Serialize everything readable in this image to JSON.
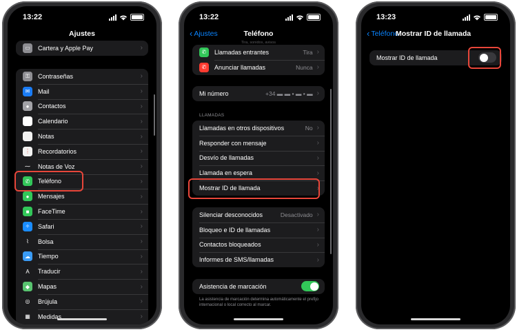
{
  "screens": {
    "ajustes": {
      "time": "13:22",
      "title": "Ajustes",
      "top_item": "Cartera y Apple Pay",
      "items": [
        {
          "label": "Contraseñas",
          "icon": "key-icon",
          "color": "#8e8e93",
          "glyph": "⚿"
        },
        {
          "label": "Mail",
          "icon": "mail-icon",
          "color": "#1a7cf5",
          "glyph": "✉"
        },
        {
          "label": "Contactos",
          "icon": "contacts-icon",
          "color": "#a2a2a7",
          "glyph": "●"
        },
        {
          "label": "Calendario",
          "icon": "calendar-icon",
          "color": "#ffffff",
          "glyph": ""
        },
        {
          "label": "Notas",
          "icon": "notes-icon",
          "color": "#f2f2f2",
          "glyph": ""
        },
        {
          "label": "Recordatorios",
          "icon": "reminders-icon",
          "color": "#f2f2f2",
          "glyph": "⋮"
        },
        {
          "label": "Notas de Voz",
          "icon": "voice-memos-icon",
          "color": "#1c1c1e",
          "glyph": "⁓"
        },
        {
          "label": "Teléfono",
          "icon": "phone-icon",
          "color": "#32c759",
          "glyph": "✆"
        },
        {
          "label": "Mensajes",
          "icon": "messages-icon",
          "color": "#32c759",
          "glyph": "●"
        },
        {
          "label": "FaceTime",
          "icon": "facetime-icon",
          "color": "#32c759",
          "glyph": "■"
        },
        {
          "label": "Safari",
          "icon": "safari-icon",
          "color": "#1a8cff",
          "glyph": "✧"
        },
        {
          "label": "Bolsa",
          "icon": "stocks-icon",
          "color": "#1c1c1e",
          "glyph": "⌇"
        },
        {
          "label": "Tiempo",
          "icon": "weather-icon",
          "color": "#3a9bf5",
          "glyph": "☁"
        },
        {
          "label": "Traducir",
          "icon": "translate-icon",
          "color": "#1c1c1e",
          "glyph": "A"
        },
        {
          "label": "Mapas",
          "icon": "maps-icon",
          "color": "#58c36f",
          "glyph": "◆"
        },
        {
          "label": "Brújula",
          "icon": "compass-icon",
          "color": "#1c1c1e",
          "glyph": "◎"
        },
        {
          "label": "Medidas",
          "icon": "measure-icon",
          "color": "#1c1c1e",
          "glyph": "▦"
        }
      ]
    },
    "telefono": {
      "time": "13:22",
      "back": "Ajustes",
      "title": "Teléfono",
      "cut_text": "Tira, sonidos, avisos",
      "top_rows": [
        {
          "label": "Llamadas entrantes",
          "value": "Tira",
          "icon": "incoming-call-icon",
          "color": "#32c759"
        },
        {
          "label": "Anunciar llamadas",
          "value": "Nunca",
          "icon": "announce-calls-icon",
          "color": "#ff3b30"
        }
      ],
      "my_number_label": "Mi número",
      "my_number_value": "+34 ▬ ▬ ▪ ▬ ▪ ▬",
      "section_header": "LLAMADAS",
      "calls_rows": [
        {
          "label": "Llamadas en otros dispositivos",
          "value": "No"
        },
        {
          "label": "Responder con mensaje",
          "value": ""
        },
        {
          "label": "Desvío de llamadas",
          "value": ""
        },
        {
          "label": "Llamada en espera",
          "value": ""
        },
        {
          "label": "Mostrar ID de llamada",
          "value": ""
        }
      ],
      "block_rows": [
        {
          "label": "Silenciar desconocidos",
          "value": "Desactivado"
        },
        {
          "label": "Bloqueo e ID de llamadas",
          "value": ""
        },
        {
          "label": "Contactos bloqueados",
          "value": ""
        },
        {
          "label": "Informes de SMS/llamadas",
          "value": ""
        }
      ],
      "assist_label": "Asistencia de marcación",
      "assist_on": true,
      "assist_footer": "La asistencia de marcación determina automáticamente el prefijo internacional o local correcto al marcar."
    },
    "mostrar_id": {
      "time": "13:23",
      "back": "Teléfono",
      "title": "Mostrar ID de llamada",
      "row_label": "Mostrar ID de llamada",
      "toggle_on": false
    }
  },
  "colors": {
    "accent": "#0a84ff",
    "highlight": "#e8463a",
    "toggle_on": "#32c759",
    "toggle_off": "#39393d"
  }
}
